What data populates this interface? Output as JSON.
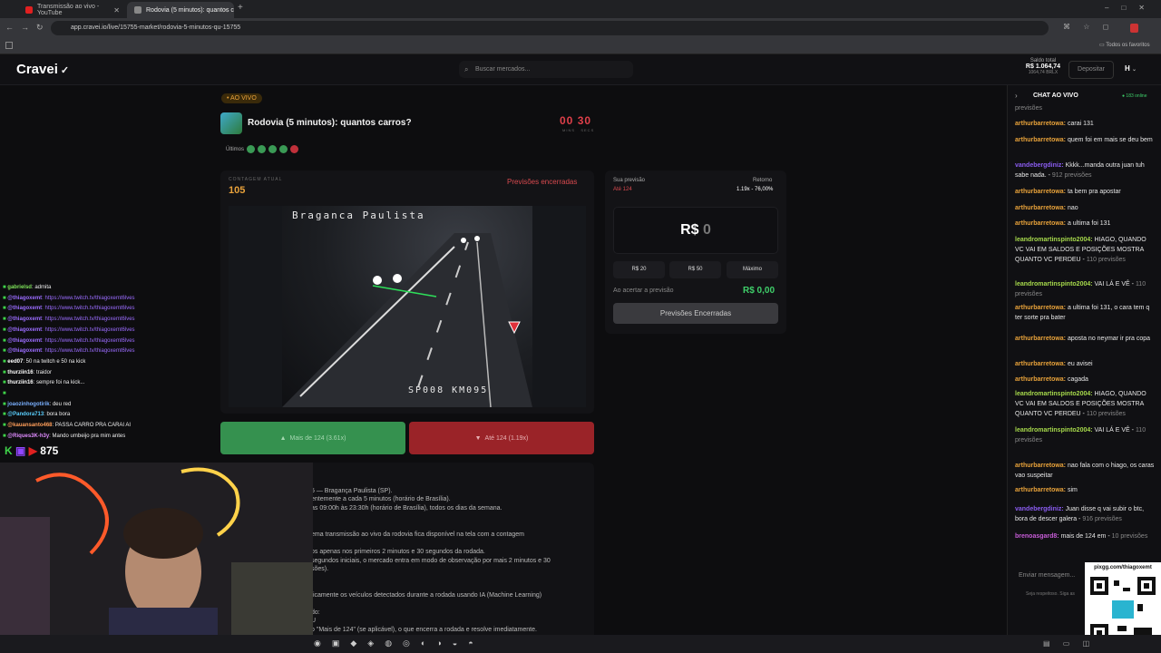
{
  "browser": {
    "tabs": [
      {
        "title": "Transmissão ao vivo - YouTube",
        "active": false
      },
      {
        "title": "Rodovia (5 minutos): quantos c",
        "active": true
      }
    ],
    "url": "app.cravei.io/live/15755-market/rodovia-5-minutos-qu-15755",
    "bookmarks_label": "Todos os favoritos"
  },
  "header": {
    "logo": "Cravei",
    "search_placeholder": "Buscar mercados...",
    "balance_label": "Saldo total",
    "balance_value": "R$ 1.064,74",
    "balance_sub": "1064,74 BRLX",
    "deposit_label": "Depositar",
    "avatar": "H"
  },
  "market": {
    "live_badge": "• AO VIVO",
    "title": "Rodovia (5 minutos): quantos carros?",
    "timer": {
      "mins": "00",
      "secs": "30",
      "mins_label": "MINS",
      "secs_label": "SECS"
    },
    "last_label": "Últimos",
    "last_results": [
      "up",
      "up",
      "up",
      "up",
      "down"
    ],
    "count_label": "CONTAGEM ATUAL",
    "count_value": "105",
    "status": "Previsões encerradas",
    "video_overlay_top": "Braganca Paulista",
    "video_overlay_bottom": "SP008  KM095",
    "btn_more": "Mais de 124 (3.61x)",
    "btn_until": "Até 124 (1.19x)"
  },
  "prediction": {
    "your_label": "Sua previsão",
    "your_value": "Até 124",
    "return_label": "Retorno",
    "return_value": "1.19x - 76,00%",
    "amount_currency": "R$",
    "amount_value": "0",
    "quick": [
      "R$ 20",
      "R$ 50",
      "Máximo"
    ],
    "payout_label": "Ao acertar a previsão",
    "payout_value": "R$ 0,00",
    "closed_button": "Previsões Encerradas"
  },
  "description": [
    "5 — Bragança Paulista (SP).",
    "entemente a cada 5 minutos (horário de Brasília).",
    "as 09:00h às 23:30h (horário de Brasília), todos os dias da semana.",
    "ema transmissão ao vivo da rodovia fica disponível na tela com a contagem",
    "os apenas nos primeiros 2 minutos e 30 segundos da rodada.",
    "segundos iniciais, o mercado entra em modo de observação por mais 2 minutos e 30",
    "sões).",
    "ticamente os veículos detectados durante a rodada usando IA (Machine Learning)",
    "do:",
    "U",
    "o \"Mais de 124\" (se aplicável), o que encerra a rodada e resolve imediatamente."
  ],
  "chat": {
    "title": "CHAT AO VIVO",
    "online": "183 online",
    "input_placeholder": "Enviar mensagem...",
    "footer": "Seja respeitoso. Siga as",
    "messages": [
      {
        "user": "",
        "text": "",
        "sub": "previsões"
      },
      {
        "user": "arthurbarretowa:",
        "text": "carai 131",
        "sub": ""
      },
      {
        "user": "arthurbarretowa:",
        "text": "quem foi em mais se deu bem",
        "sub": ""
      },
      {
        "user": "vandebergdiniz:",
        "text": "Kkkk...manda outra juan tuh sabe nada.",
        "sub": "912 previsões"
      },
      {
        "user": "arthurbarretowa:",
        "text": "ta bem pra apostar",
        "sub": ""
      },
      {
        "user": "arthurbarretowa:",
        "text": "nao",
        "sub": ""
      },
      {
        "user": "arthurbarretowa:",
        "text": "a ultima foi 131",
        "sub": ""
      },
      {
        "user": "leandromartinspinto2004:",
        "text": "HIAGO, QUANDO VC VAI EM SALDOS E POSIÇÕES MOSTRA QUANTO VC PERDEU",
        "sub": "110 previsões"
      },
      {
        "user": "leandromartinspinto2004:",
        "text": "VAI LÁ E VÊ",
        "sub": "110 previsões"
      },
      {
        "user": "arthurbarretowa:",
        "text": "a ultima foi 131, o cara tem q ter sorte pra bater",
        "sub": ""
      },
      {
        "user": "arthurbarretowa:",
        "text": "aposta no neymar ir pra copa",
        "sub": ""
      },
      {
        "user": "arthurbarretowa:",
        "text": "eu avisei",
        "sub": ""
      },
      {
        "user": "arthurbarretowa:",
        "text": "cagada",
        "sub": ""
      },
      {
        "user": "leandromartinspinto2004:",
        "text": "HIAGO, QUANDO VC VAI EM SALDOS E POSIÇÕES MOSTRA QUANTO VC PERDEU",
        "sub": "110 previsões"
      },
      {
        "user": "leandromartinspinto2004:",
        "text": "VAI LÁ E VÊ",
        "sub": "110 previsões"
      },
      {
        "user": "arthurbarretowa:",
        "text": "nao fala com o hiago, os caras vao suspeitar",
        "sub": ""
      },
      {
        "user": "arthurbarretowa:",
        "text": "sim",
        "sub": ""
      },
      {
        "user": "vandebergdiniz:",
        "text": "Juan disse q vai subir o btc, bora de descer galera",
        "sub": "916 previsões"
      },
      {
        "user": "brenoasgard8:",
        "text": "mais de 124 em",
        "sub": "10 previsões"
      }
    ]
  },
  "stream_overlay": {
    "messages": [
      {
        "user": "gabrielsd",
        "text": ": admita"
      },
      {
        "user": "@thiagoxemt",
        "text": ": https://www.twitch.tv/thiagoxemt6lves"
      },
      {
        "user": "@thiagoxemt",
        "text": ": https://www.twitch.tv/thiagoxemt6lves"
      },
      {
        "user": "@thiagoxemt",
        "text": ": https://www.twitch.tv/thiagoxemt6lves"
      },
      {
        "user": "@thiagoxemt",
        "text": ": https://www.twitch.tv/thiagoxemt6lves"
      },
      {
        "user": "@thiagoxemt",
        "text": ": https://www.twitch.tv/thiagoxemt6lves"
      },
      {
        "user": "@thiagoxemt",
        "text": ": https://www.twitch.tv/thiagoxemt6lves"
      },
      {
        "user": "eed07",
        "text": ": 50 na twitch e 50 na kick"
      },
      {
        "user": "thurziin16",
        "text": ": traidor"
      },
      {
        "user": "thurziin16",
        "text": ": sempre foi na kick..."
      },
      {
        "user": "",
        "text": ""
      },
      {
        "user": "joaozinhogotirik",
        "text": ": deu red"
      },
      {
        "user": "@Pandora713",
        "text": ": bora bora"
      },
      {
        "user": "@kauansanto468",
        "text": ": PASSA CARRO PRA CARAI AI"
      },
      {
        "user": "@Riques3K-h3y",
        "text": ": Mando umbeijo pra mim antes"
      }
    ],
    "viewer_count": "875",
    "qr_label": "pixgg.com/thiagoxemt"
  },
  "colors": {
    "accent_green": "#35914f",
    "accent_red": "#9a2328",
    "timer_red": "#e0404a",
    "count_orange": "#e9a23b",
    "chat_user_orange": "#e8a23a",
    "chat_user_green": "#a6d94b",
    "chat_user_purple": "#8a5cf0"
  }
}
